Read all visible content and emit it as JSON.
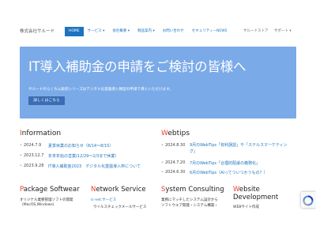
{
  "header": {
    "company": "株式会社サルード",
    "nav": [
      "HOME",
      "サービス ▾",
      "会社概要 ▾",
      "製品案内 ▾",
      "お問い合わせ",
      "セキュリティーNEWS"
    ],
    "nav_right": [
      "サルードストア",
      "サポート ▾"
    ]
  },
  "hero": {
    "title": "IT導入補助金の申請をご検討の皆様へ",
    "subtitle": "サルードのらくちん販売シリーズはデジタル化基盤導入類型の申請で導入いただけます。",
    "button": "詳しくはこちら"
  },
  "information": {
    "initial": "I",
    "rest": "nformation",
    "items": [
      {
        "date": "2024.7.9",
        "text": "夏季休業のお知らせ（8/14～8/15）"
      },
      {
        "date": "2023.12.7",
        "text": "年末年始の営業(12/29～1/3まで休業）"
      },
      {
        "date": "2023.9.28",
        "text": "IT導入補助金2023　デジタル化基盤導入枠について"
      }
    ]
  },
  "webtips": {
    "initial": "W",
    "rest": "ebtips",
    "items": [
      {
        "date": "2024.8.30",
        "text": "9月のWebTips「有利誤認」や「ステルスマーケティング」"
      },
      {
        "date": "2024.7.20",
        "text": "7月のWebTips「合理的配慮の義務化」"
      },
      {
        "date": "2024.6.30",
        "text": "6月のWebTips（AIってついつかうもの？）"
      }
    ]
  },
  "services": [
    {
      "initial": "P",
      "rest": "ackage Softwear",
      "sub1": "オリジナル業務管理ソフトの開発",
      "sub2": "(MacOS,Windows)"
    },
    {
      "initial": "N",
      "rest": "etwork Service",
      "sub1": "ic-net.サービス",
      "sub2": "ウイルスチェックメールサービス"
    },
    {
      "initial": "S",
      "rest": "ystem Consulting",
      "sub1": "業務にマッチしたシステム設計から",
      "sub2": "ソフトウエア開発・システム構築・"
    },
    {
      "initial": "W",
      "rest": "ebsite Development",
      "sub1": "WEBサイト作成",
      "sub2": ""
    }
  ],
  "colors": {
    "accent": "#1e73be",
    "hero_bg": "#7aaae8",
    "initial": "#e8432e"
  },
  "icons": {
    "recaptcha": "recaptcha-icon"
  }
}
